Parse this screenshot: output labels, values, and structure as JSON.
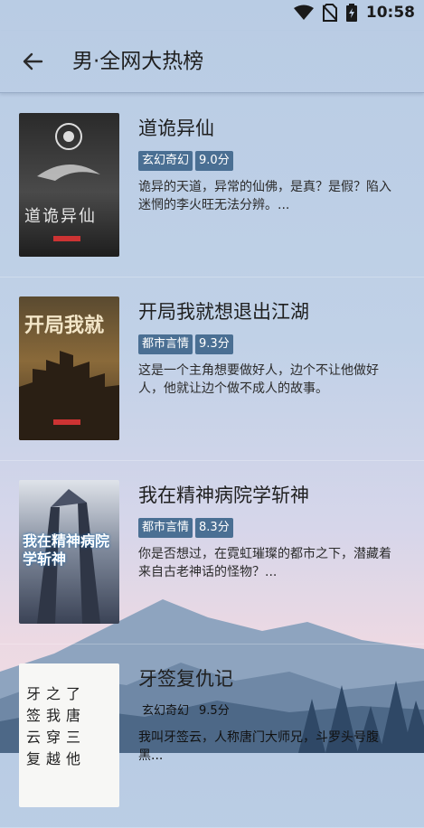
{
  "status": {
    "time": "10:58"
  },
  "header": {
    "title": "男·全网大热榜"
  },
  "books": [
    {
      "title": "道诡异仙",
      "tags": [
        "玄幻奇幻",
        "9.0分"
      ],
      "description": "诡异的天道，异常的仙佛，是真？是假？陷入迷惘的李火旺无法分辨。...",
      "cover_text": "道诡异仙"
    },
    {
      "title": "开局我就想退出江湖",
      "tags": [
        "都市言情",
        "9.3分"
      ],
      "description": "这是一个主角想要做好人，边个不让他做好人，他就让边个做不成人的故事。",
      "cover_text": "开局我就"
    },
    {
      "title": "我在精神病院学斩神",
      "tags": [
        "都市言情",
        "8.3分"
      ],
      "description": "你是否想过，在霓虹璀璨的都市之下，潜藏着来自古老神话的怪物？...",
      "cover_text": "我在精神病院学斩神"
    },
    {
      "title": "牙签复仇记",
      "tags": [
        "玄幻奇幻",
        "9.5分"
      ],
      "description": "我叫牙签云，人称唐门大师兄，斗罗头号腹黑...",
      "cover_text": "牙之了签我唐云穿三复越他"
    }
  ]
}
